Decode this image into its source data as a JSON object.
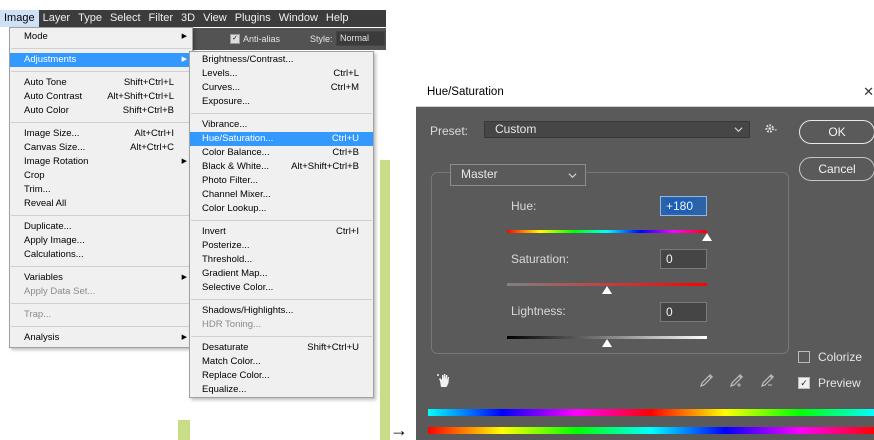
{
  "menubar": {
    "items": [
      "Image",
      "Layer",
      "Type",
      "Select",
      "Filter",
      "3D",
      "View",
      "Plugins",
      "Window",
      "Help"
    ]
  },
  "options_bar": {
    "antialias_label": "Anti-alias",
    "style_label": "Style:",
    "style_value": "Normal"
  },
  "image_menu": {
    "items": [
      {
        "label": "Mode",
        "shortcut": "",
        "submenu": true
      },
      {
        "label": "Adjustments",
        "shortcut": "",
        "submenu": true,
        "highlighted": true
      },
      {
        "label": "Auto Tone",
        "shortcut": "Shift+Ctrl+L"
      },
      {
        "label": "Auto Contrast",
        "shortcut": "Alt+Shift+Ctrl+L"
      },
      {
        "label": "Auto Color",
        "shortcut": "Shift+Ctrl+B"
      },
      {
        "label": "Image Size...",
        "shortcut": "Alt+Ctrl+I"
      },
      {
        "label": "Canvas Size...",
        "shortcut": "Alt+Ctrl+C"
      },
      {
        "label": "Image Rotation",
        "shortcut": "",
        "submenu": true
      },
      {
        "label": "Crop",
        "shortcut": ""
      },
      {
        "label": "Trim...",
        "shortcut": ""
      },
      {
        "label": "Reveal All",
        "shortcut": ""
      },
      {
        "label": "Duplicate...",
        "shortcut": ""
      },
      {
        "label": "Apply Image...",
        "shortcut": ""
      },
      {
        "label": "Calculations...",
        "shortcut": ""
      },
      {
        "label": "Variables",
        "shortcut": "",
        "submenu": true
      },
      {
        "label": "Apply Data Set...",
        "shortcut": "",
        "disabled": true
      },
      {
        "label": "Trap...",
        "shortcut": "",
        "disabled": true
      },
      {
        "label": "Analysis",
        "shortcut": "",
        "submenu": true
      }
    ]
  },
  "adjustments_menu": {
    "items": [
      {
        "label": "Brightness/Contrast...",
        "shortcut": ""
      },
      {
        "label": "Levels...",
        "shortcut": "Ctrl+L"
      },
      {
        "label": "Curves...",
        "shortcut": "Ctrl+M"
      },
      {
        "label": "Exposure...",
        "shortcut": ""
      },
      {
        "label": "Vibrance...",
        "shortcut": ""
      },
      {
        "label": "Hue/Saturation...",
        "shortcut": "Ctrl+U",
        "highlighted": true
      },
      {
        "label": "Color Balance...",
        "shortcut": "Ctrl+B"
      },
      {
        "label": "Black & White...",
        "shortcut": "Alt+Shift+Ctrl+B"
      },
      {
        "label": "Photo Filter...",
        "shortcut": ""
      },
      {
        "label": "Channel Mixer...",
        "shortcut": ""
      },
      {
        "label": "Color Lookup...",
        "shortcut": ""
      },
      {
        "label": "Invert",
        "shortcut": "Ctrl+I"
      },
      {
        "label": "Posterize...",
        "shortcut": ""
      },
      {
        "label": "Threshold...",
        "shortcut": ""
      },
      {
        "label": "Gradient Map...",
        "shortcut": ""
      },
      {
        "label": "Selective Color...",
        "shortcut": ""
      },
      {
        "label": "Shadows/Highlights...",
        "shortcut": ""
      },
      {
        "label": "HDR Toning...",
        "shortcut": "",
        "disabled": true
      },
      {
        "label": "Desaturate",
        "shortcut": "Shift+Ctrl+U"
      },
      {
        "label": "Match Color...",
        "shortcut": ""
      },
      {
        "label": "Replace Color...",
        "shortcut": ""
      },
      {
        "label": "Equalize...",
        "shortcut": ""
      }
    ]
  },
  "arrow": "→",
  "dialog": {
    "title": "Hue/Saturation",
    "close": "✕",
    "preset_label": "Preset:",
    "preset_value": "Custom",
    "ok_label": "OK",
    "cancel_label": "Cancel",
    "channel_value": "Master",
    "hue_label": "Hue:",
    "hue_value": "+180",
    "saturation_label": "Saturation:",
    "saturation_value": "0",
    "lightness_label": "Lightness:",
    "lightness_value": "0",
    "colorize_label": "Colorize",
    "colorize_checked": false,
    "preview_label": "Preview",
    "preview_checked": true,
    "hue_slider_fraction": 1.0,
    "saturation_slider_fraction": 0.5,
    "lightness_slider_fraction": 0.5,
    "accent_color": "#2b63a8",
    "background_color": "#5a5a5a"
  },
  "icons": [
    "gear-icon",
    "chevron-down-icon",
    "hand-icon",
    "eyedropper-icon",
    "eyedropper-plus-icon",
    "eyedropper-minus-icon",
    "close-icon"
  ]
}
